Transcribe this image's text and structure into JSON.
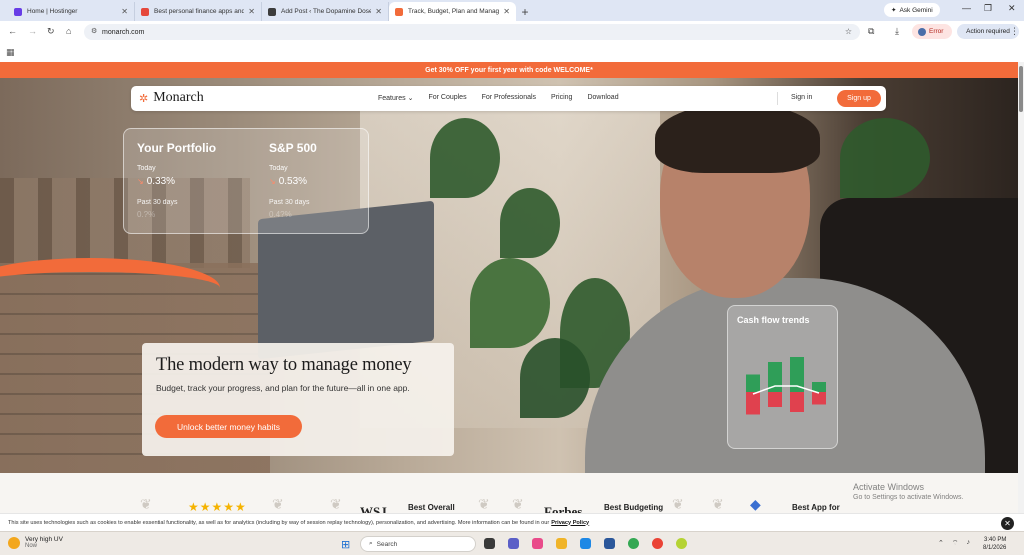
{
  "browser": {
    "tabs": [
      {
        "title": "Home | Hostinger",
        "color": "#673de6",
        "active": false
      },
      {
        "title": "Best personal finance apps and",
        "color": "#e5483b",
        "active": false
      },
      {
        "title": "Add Post ‹ The Dopamine Dose",
        "color": "#3c3c3c",
        "active": false
      },
      {
        "title": "Track, Budget, Plan and Manage",
        "color": "#f26b3a",
        "active": true
      }
    ],
    "new_tab": "+",
    "ask_gemini": "Ask Gemini",
    "url": "monarch.com",
    "error_label": "Error",
    "action_required": "Action required"
  },
  "promo": {
    "text": "Get 30% OFF your first year with code WELCOME*"
  },
  "site_nav": {
    "brand": "Monarch",
    "links": [
      "Features ⌄",
      "For Couples",
      "For Professionals",
      "Pricing",
      "Download"
    ],
    "sign_in": "Sign in",
    "sign_up": "Sign up"
  },
  "portfolio": {
    "left": {
      "title": "Your Portfolio",
      "today_label": "Today",
      "today_value": "0.33%",
      "past_label": "Past 30 days",
      "past_value": "0.?%"
    },
    "right": {
      "title": "S&P 500",
      "today_label": "Today",
      "today_value": "0.53%",
      "past_label": "Past 30 days",
      "past_value": "0.4?%"
    }
  },
  "hero": {
    "headline": "The modern way to manage money",
    "subtext": "Budget, track your progress, and plan for the future—all in one app.",
    "cta": "Unlock better money habits"
  },
  "cash_flow": {
    "title": "Cash flow trends",
    "colors": {
      "income": "#2f9e58",
      "expense": "#e0414e"
    },
    "bars": [
      {
        "income": 0.35,
        "expense": 0.45
      },
      {
        "income": 0.6,
        "expense": 0.3
      },
      {
        "income": 0.7,
        "expense": 0.4
      },
      {
        "income": 0.2,
        "expense": 0.25
      }
    ]
  },
  "awards": {
    "items": [
      {
        "label": "Best Overall"
      },
      {
        "label": "Best Budgeting"
      },
      {
        "label": "Best App for"
      }
    ],
    "stars": "★★★★★",
    "word1": "WSJ",
    "word2": "Forbes"
  },
  "windows_watermark": {
    "line1": "Activate Windows",
    "line2": "Go to Settings to activate Windows."
  },
  "cookie": {
    "text": "This site uses technologies such as cookies to enable essential functionality, as well as for analytics (including by way of session replay technology), personalization, and advertising. More information can be found in our",
    "link": "Privacy Policy",
    "close": "✕"
  },
  "taskbar": {
    "weather_title": "Very high UV",
    "weather_sub": "Now",
    "search_placeholder": "Search",
    "time": "3:40 PM",
    "date": "8/1/2026"
  }
}
